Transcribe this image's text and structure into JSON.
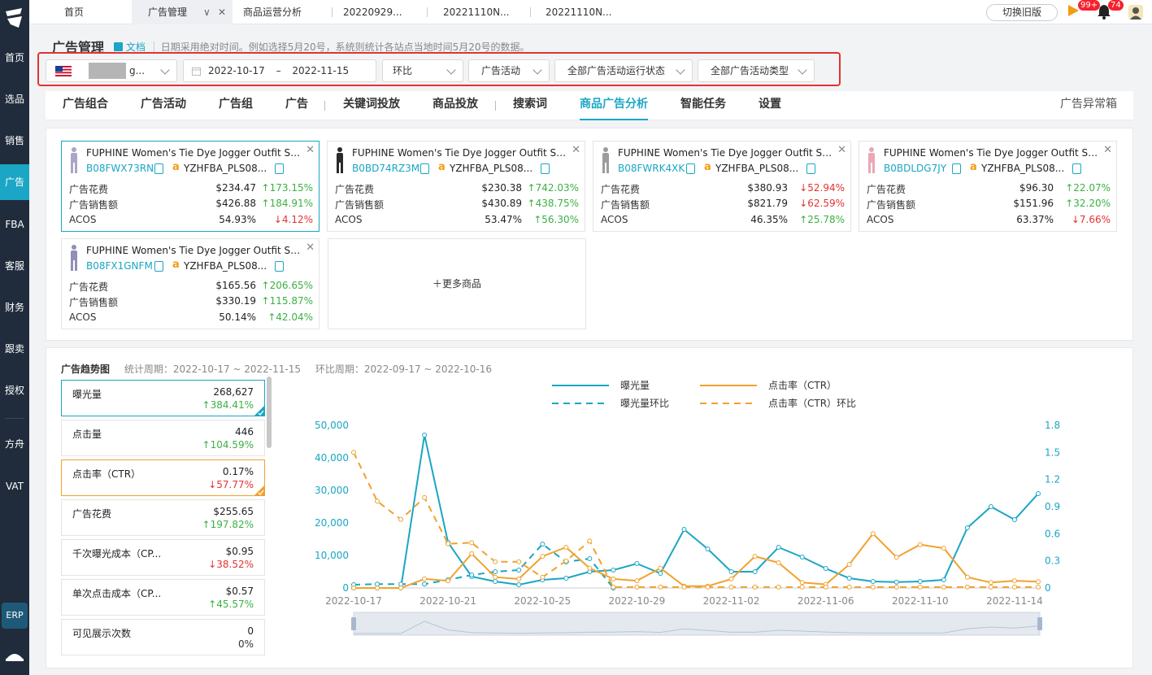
{
  "sidebar": {
    "items": [
      {
        "label": "首页"
      },
      {
        "label": "选品"
      },
      {
        "label": "销售"
      },
      {
        "label": "广告"
      },
      {
        "label": "FBA"
      },
      {
        "label": "客服"
      },
      {
        "label": "财务"
      },
      {
        "label": "跟卖"
      },
      {
        "label": "授权"
      },
      {
        "label": "方舟"
      },
      {
        "label": "VAT"
      }
    ],
    "erp": "ERP"
  },
  "topbar": {
    "tabs": [
      {
        "label": "首页"
      },
      {
        "label": "广告管理"
      },
      {
        "label": "商品运营分析"
      },
      {
        "label": "20220929..."
      },
      {
        "label": "20221110N..."
      },
      {
        "label": "20221110N..."
      }
    ],
    "switch_old": "切换旧版",
    "flag_badge": "99+",
    "bell_badge": "74"
  },
  "page": {
    "title": "广告管理",
    "doc_link": "文档",
    "note": "日期采用绝对时间。例如选择5月20号，系统则统计各站点当地时间5月20号的数据。"
  },
  "filters": {
    "store_suffix": "g...",
    "date_start": "2022-10-17",
    "date_sep": "–",
    "date_end": "2022-11-15",
    "compare": "环比",
    "campaign": "广告活动",
    "run_state": "全部广告活动运行状态",
    "campaign_type": "全部广告活动类型"
  },
  "subnav": {
    "tabs": [
      {
        "label": "广告组合"
      },
      {
        "label": "广告活动"
      },
      {
        "label": "广告组"
      },
      {
        "label": "广告"
      },
      {
        "label": "关键词投放"
      },
      {
        "label": "商品投放"
      },
      {
        "label": "搜索词"
      },
      {
        "label": "商品广告分析"
      },
      {
        "label": "智能任务"
      },
      {
        "label": "设置"
      }
    ],
    "right": "广告异常箱"
  },
  "labels": {
    "spend": "广告花费",
    "sales": "广告销售额",
    "acos": "ACOS"
  },
  "products": [
    {
      "name": "FUPHINE Women's Tie Dye Jogger Outfit Swe...",
      "asin": "B08FWX73RN",
      "sku": "YZHFBA_PLS08...",
      "spend": "$234.47",
      "spend_chg": "↑173.15%",
      "sales": "$426.88",
      "sales_chg": "↑184.91%",
      "acos": "54.93%",
      "acos_chg": "↓4.12%",
      "thumb": "#a9a6c9"
    },
    {
      "name": "FUPHINE Women's Tie Dye Jogger Outfit Swe...",
      "asin": "B0BD74RZ3M",
      "sku": "YZHFBA_PLS08...",
      "spend": "$230.38",
      "spend_chg": "↑742.03%",
      "sales": "$430.89",
      "sales_chg": "↑438.75%",
      "acos": "53.47%",
      "acos_chg": "↑56.30%",
      "thumb": "#2b2b2b"
    },
    {
      "name": "FUPHINE Women's Tie Dye Jogger Outfit Swe...",
      "asin": "B08FWRK4XK",
      "sku": "YZHFBA_PLS08...",
      "spend": "$380.93",
      "spend_chg": "↓52.94%",
      "sales": "$821.79",
      "sales_chg": "↓62.59%",
      "acos": "46.35%",
      "acos_chg": "↑25.78%",
      "thumb": "#9c9c9c"
    },
    {
      "name": "FUPHINE Women's Tie Dye Jogger Outfit Swe...",
      "asin": "B0BDLDG7JY",
      "sku": "YZHFBA_PLS08...",
      "spend": "$96.30",
      "spend_chg": "↑22.07%",
      "sales": "$151.96",
      "sales_chg": "↑32.20%",
      "acos": "63.37%",
      "acos_chg": "↓7.66%",
      "thumb": "#e9a8b4"
    },
    {
      "name": "FUPHINE Women's Tie Dye Jogger Outfit Swe...",
      "asin": "B08FX1GNFM",
      "sku": "YZHFBA_PLS08...",
      "spend": "$165.56",
      "spend_chg": "↑206.65%",
      "sales": "$330.19",
      "sales_chg": "↑115.87%",
      "acos": "50.14%",
      "acos_chg": "↑42.04%",
      "thumb": "#8f8fb8"
    }
  ],
  "more_products": "＋更多商品",
  "trend": {
    "title": "广告趋势图",
    "period": "统计周期：2022-10-17 ~ 2022-11-15",
    "compare_period": "环比周期：2022-09-17 ~ 2022-10-16",
    "metrics": [
      {
        "label": "曝光量",
        "value": "268,627",
        "change": "↑384.41%"
      },
      {
        "label": "点击量",
        "value": "446",
        "change": "↑104.59%"
      },
      {
        "label": "点击率（CTR）",
        "value": "0.17%",
        "change": "↓57.77%"
      },
      {
        "label": "广告花费",
        "value": "$255.65",
        "change": "↑197.82%"
      },
      {
        "label": "千次曝光成本（CP...",
        "value": "$0.95",
        "change": "↓38.52%"
      },
      {
        "label": "单次点击成本（CP...",
        "value": "$0.57",
        "change": "↑45.57%"
      },
      {
        "label": "可见展示次数",
        "value": "0",
        "change": "0%"
      }
    ]
  },
  "colors": {
    "teal": "#1aa6c4",
    "orange": "#f0a22e",
    "up": "#3cb043",
    "down": "#e33232"
  },
  "chart_data": {
    "type": "line",
    "x": [
      "2022-10-17",
      "2022-10-18",
      "2022-10-19",
      "2022-10-20",
      "2022-10-21",
      "2022-10-22",
      "2022-10-23",
      "2022-10-24",
      "2022-10-25",
      "2022-10-26",
      "2022-10-27",
      "2022-10-28",
      "2022-10-29",
      "2022-10-30",
      "2022-10-31",
      "2022-11-01",
      "2022-11-02",
      "2022-11-03",
      "2022-11-04",
      "2022-11-05",
      "2022-11-06",
      "2022-11-07",
      "2022-11-08",
      "2022-11-09",
      "2022-11-10",
      "2022-11-11",
      "2022-11-12",
      "2022-11-13",
      "2022-11-14",
      "2022-11-15"
    ],
    "x_ticks": [
      "2022-10-17",
      "2022-10-21",
      "2022-10-25",
      "2022-10-29",
      "2022-11-02",
      "2022-11-06",
      "2022-11-10",
      "2022-11-14"
    ],
    "y_left": {
      "ticks": [
        "0",
        "10,000",
        "20,000",
        "30,000",
        "40,000",
        "50,000"
      ],
      "range": [
        0,
        50000
      ]
    },
    "y_right": {
      "ticks": [
        "0",
        "0.3",
        "0.6",
        "0.9",
        "1.2",
        "1.5",
        "1.8"
      ],
      "range": [
        0,
        1.8
      ]
    },
    "legend": [
      {
        "name": "曝光量",
        "style": "solid",
        "color": "#1aa6c4"
      },
      {
        "name": "点击率（CTR）",
        "style": "solid",
        "color": "#f0a22e"
      },
      {
        "name": "曝光量环比",
        "style": "dashed",
        "color": "#1aa6c4"
      },
      {
        "name": "点击率（CTR）环比",
        "style": "dashed",
        "color": "#f0a22e"
      }
    ],
    "series": [
      {
        "name": "曝光量",
        "axis": "left",
        "style": "solid",
        "color": "#1aa6c4",
        "values": [
          0,
          0,
          0,
          47000,
          14000,
          3500,
          2000,
          1000,
          2500,
          3000,
          5000,
          5500,
          7500,
          4500,
          18000,
          12000,
          5000,
          5000,
          12500,
          9500,
          6000,
          3000,
          2000,
          1800,
          2000,
          2500,
          18500,
          25000,
          21000,
          29000
        ]
      },
      {
        "name": "曝光量环比",
        "axis": "left",
        "style": "dashed",
        "color": "#1aa6c4",
        "values": [
          1000,
          1200,
          1200,
          1200,
          2500,
          4000,
          5000,
          5500,
          13500,
          8000,
          9000,
          0,
          null,
          null,
          null,
          null,
          null,
          null,
          null,
          null,
          null,
          null,
          null,
          null,
          null,
          null,
          null,
          null,
          null,
          null
        ]
      },
      {
        "name": "点击率（CTR）",
        "axis": "right",
        "style": "solid",
        "color": "#f0a22e",
        "values": [
          0,
          0,
          0,
          0.1,
          0.08,
          0.38,
          0.12,
          0.1,
          0.35,
          0.45,
          0.22,
          0.1,
          0.08,
          0.22,
          0.02,
          0.02,
          0.1,
          0.35,
          0.28,
          0.06,
          0.04,
          0.26,
          0.6,
          0.34,
          0.48,
          0.44,
          0.12,
          0.06,
          0.08,
          0.07
        ]
      },
      {
        "name": "点击率（CTR）环比",
        "axis": "right",
        "style": "dashed",
        "color": "#f0a22e",
        "values": [
          1.5,
          0.96,
          0.76,
          1.0,
          0.49,
          0.5,
          0.29,
          0.29,
          0.12,
          0.3,
          0.52,
          0.01,
          0.01,
          0.01,
          0.01,
          0.01,
          0.01,
          0.01,
          0.01,
          0.01,
          0.01,
          0.01,
          0.01,
          0.01,
          0.01,
          0.01,
          0.01,
          0.01,
          0.01,
          0.01
        ]
      }
    ]
  }
}
